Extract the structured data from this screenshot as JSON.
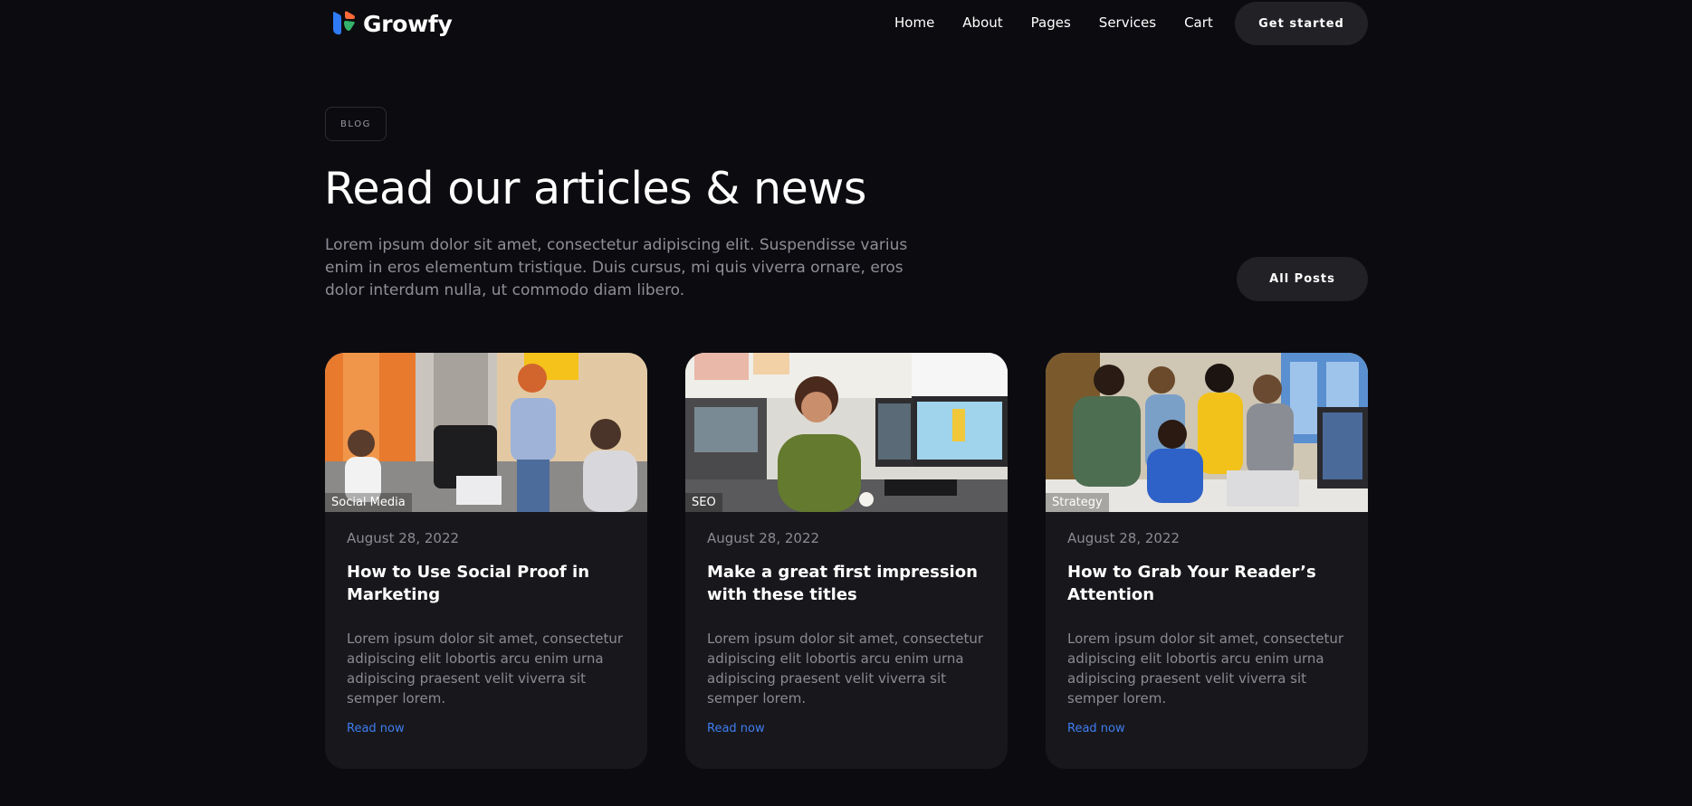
{
  "brand": {
    "name": "Growfy"
  },
  "nav": {
    "items": [
      "Home",
      "About",
      "Pages",
      "Services",
      "Cart"
    ],
    "cta": "Get started"
  },
  "hero": {
    "tag": "BLOG",
    "title": "Read our articles & news",
    "intro": "Lorem ipsum dolor sit amet, consectetur adipiscing elit. Suspendisse varius enim in eros elementum tristique. Duis cursus, mi quis viverra ornare, eros dolor interdum nulla, ut commodo diam libero.",
    "all_posts": "All Posts"
  },
  "posts": [
    {
      "category": "Social Media",
      "date": "August 28, 2022",
      "title": "How to Use Social Proof in Marketing",
      "excerpt": "Lorem ipsum dolor sit amet, consectetur adipiscing elit lobortis arcu enim urna adipiscing praesent velit viverra sit semper lorem.",
      "link": "Read now"
    },
    {
      "category": "SEO",
      "date": "August 28, 2022",
      "title": "Make a great first impression with these titles",
      "excerpt": "Lorem ipsum dolor sit amet, consectetur adipiscing elit lobortis arcu enim urna adipiscing praesent velit viverra sit semper lorem.",
      "link": "Read now"
    },
    {
      "category": "Strategy",
      "date": "August 28, 2022",
      "title": "How to Grab Your Reader’s Attention",
      "excerpt": "Lorem ipsum dolor sit amet, consectetur adipiscing elit lobortis arcu enim urna adipiscing praesent velit viverra sit semper lorem.",
      "link": "Read now"
    }
  ],
  "colors": {
    "background": "#0c0c10",
    "card": "#18181c",
    "button": "#222226",
    "link": "#3f7df0",
    "muted_text": "#8a8a92"
  }
}
